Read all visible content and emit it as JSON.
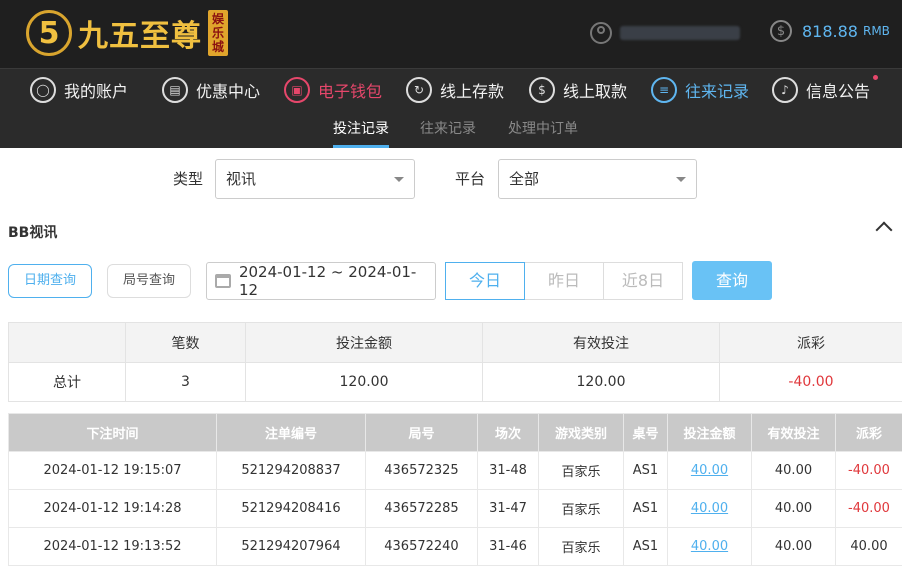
{
  "header": {
    "logo_numeral": "5",
    "logo_text": "九五至尊",
    "logo_badge": [
      "娱",
      "乐",
      "城"
    ],
    "balance_amount": "818.88",
    "balance_unit": "RMB",
    "balance_symbol": "$"
  },
  "main_nav": [
    {
      "label": "我的账户",
      "icon": "user-icon"
    },
    {
      "label": "优惠中心",
      "icon": "gift-icon"
    },
    {
      "label": "电子钱包",
      "icon": "wallet-icon"
    },
    {
      "label": "线上存款",
      "icon": "deposit-icon"
    },
    {
      "label": "线上取款",
      "icon": "withdraw-icon"
    },
    {
      "label": "往来记录",
      "icon": "records-icon"
    },
    {
      "label": "信息公告",
      "icon": "bell-icon"
    }
  ],
  "sub_nav": [
    "投注记录",
    "往来记录",
    "处理中订单"
  ],
  "filters": {
    "type_label": "类型",
    "type_value": "视讯",
    "platform_label": "平台",
    "platform_value": "全部"
  },
  "section_title": "BB视讯",
  "query": {
    "date_query": "日期查询",
    "round_query": "局号查询",
    "date_range": "2024-01-12 ~ 2024-01-12",
    "today": "今日",
    "yesterday": "昨日",
    "last8": "近8日",
    "search": "查询"
  },
  "summary": {
    "headers": [
      "",
      "笔数",
      "投注金额",
      "有效投注",
      "派彩"
    ],
    "row": [
      "总计",
      "3",
      "120.00",
      "120.00",
      "-40.00"
    ]
  },
  "detail": {
    "headers": [
      "下注时间",
      "注单编号",
      "局号",
      "场次",
      "游戏类别",
      "桌号",
      "投注金额",
      "有效投注",
      "派彩"
    ],
    "rows": [
      [
        "2024-01-12 19:15:07",
        "521294208837",
        "436572325",
        "31-48",
        "百家乐",
        "AS1",
        "40.00",
        "40.00",
        "-40.00"
      ],
      [
        "2024-01-12 19:14:28",
        "521294208416",
        "436572285",
        "31-47",
        "百家乐",
        "AS1",
        "40.00",
        "40.00",
        "-40.00"
      ],
      [
        "2024-01-12 19:13:52",
        "521294207964",
        "436572240",
        "31-46",
        "百家乐",
        "AS1",
        "40.00",
        "40.00",
        "40.00"
      ]
    ]
  }
}
